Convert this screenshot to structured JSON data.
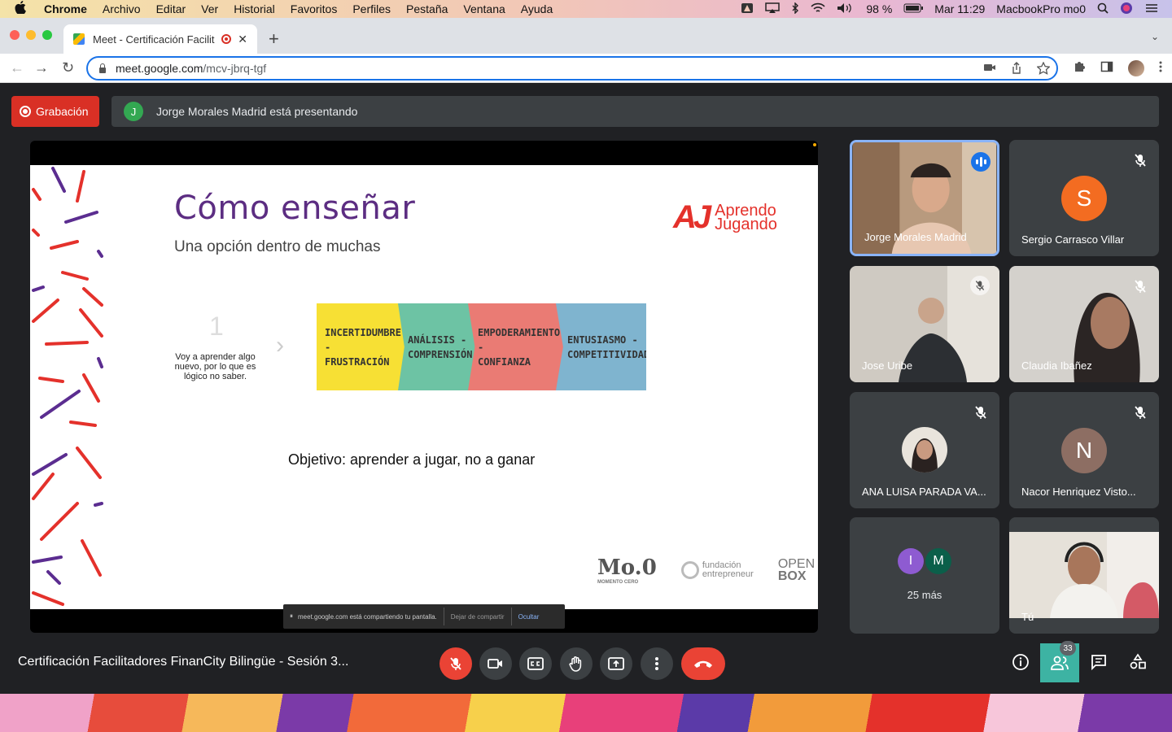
{
  "menubar": {
    "apple": "",
    "app": "Chrome",
    "items": [
      "Archivo",
      "Editar",
      "Ver",
      "Historial",
      "Favoritos",
      "Perfiles",
      "Pestaña",
      "Ventana",
      "Ayuda"
    ],
    "battery": "98 %",
    "clock": "Mar 11:29",
    "computer_name": "MacbookPro mo0"
  },
  "browser": {
    "tab_title": "Meet - Certificación Facilitadores",
    "url_host": "meet.google.com",
    "url_path": "/mcv-jbrq-tgf"
  },
  "meet": {
    "recording_label": "Grabación",
    "presenter_initial": "J",
    "presenter_text": "Jorge Morales Madrid está presentando",
    "meeting_title": "Certificación Facilitadores FinanCity Bilingüe - Sesión 3...",
    "people_count": "33"
  },
  "slide": {
    "title": "Cómo enseñar",
    "subtitle": "Una opción dentro de muchas",
    "brand_mark": "AJ",
    "brand_line1": "Aprendo",
    "brand_line2": "Jugando",
    "step_number": "1",
    "step_text": "Voy a aprender algo nuevo, por lo que es lógico no saber.",
    "stages": [
      {
        "line1": "INCERTIDUMBRE -",
        "line2": "FRUSTRACIÓN",
        "color": "#f7e034"
      },
      {
        "line1": "ANÁLISIS -",
        "line2": "COMPRENSIÓN",
        "color": "#6dc3a4"
      },
      {
        "line1": "EMPODERAMIENTO -",
        "line2": "CONFIANZA",
        "color": "#ea7b74"
      },
      {
        "line1": "ENTUSIASMO -",
        "line2": "COMPETITIVIDAD",
        "color": "#7fb4cf"
      }
    ],
    "objective": "Objetivo: aprender a jugar, no a ganar",
    "sponsor1": "Mo.0",
    "sponsor1_sub": "MOMENTO CERO",
    "sponsor2_line1": "fundación",
    "sponsor2_line2": "entrepreneur",
    "sponsor3_line1": "OPEN",
    "sponsor3_line2": "BOX"
  },
  "sharebar": {
    "text": "meet.google.com está compartiendo tu pantalla.",
    "stop": "Dejar de compartir",
    "hide": "Ocultar"
  },
  "participants": [
    {
      "name": "Jorge Morales Madrid",
      "type": "video"
    },
    {
      "name": "Sergio Carrasco Villar",
      "initial": "S",
      "color": "#f36c21"
    },
    {
      "name": "Jose Uribe",
      "type": "video"
    },
    {
      "name": "Claudia Ibañez",
      "type": "video"
    },
    {
      "name": "ANA LUISA PARADA VA...",
      "type": "avatar"
    },
    {
      "name": "Nacor Henriquez Visto...",
      "initial": "N",
      "color": "#8d6e63"
    },
    {
      "more_label": "25 más",
      "initials": [
        "I",
        "M"
      ],
      "colors": [
        "#8e5bd1",
        "#0b5f4a"
      ]
    },
    {
      "name": "Tú",
      "type": "video"
    }
  ],
  "colors": {
    "meet_bg": "#202124",
    "tile_bg": "#3c4043",
    "record_red": "#d93025",
    "hangup_red": "#ea4335",
    "people_active": "#3db3a3",
    "slide_title": "#5c2d82",
    "brand_red": "#e4312b"
  }
}
